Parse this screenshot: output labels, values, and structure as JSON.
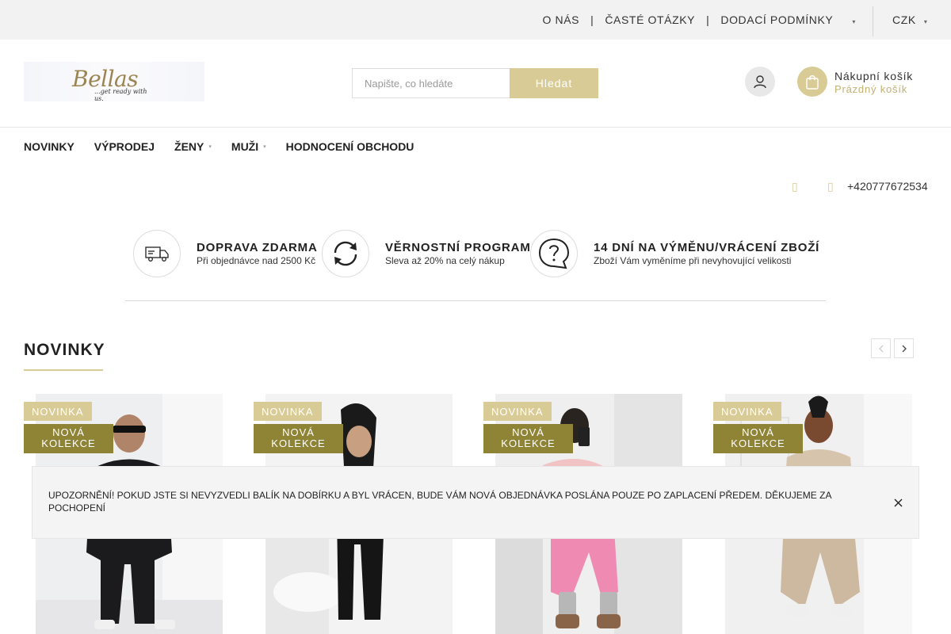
{
  "topbar": {
    "links": [
      "O NÁS",
      "ČASTÉ OTÁZKY",
      "DODACÍ PODMÍNKY"
    ],
    "separator": "|",
    "currency": "CZK"
  },
  "header": {
    "logo_text": "Bellas",
    "logo_tagline": "...get ready with us.",
    "search_placeholder": "Napište, co hledáte",
    "search_button": "Hledat",
    "cart_title": "Nákupní košík",
    "cart_status": "Prázdný košík"
  },
  "nav": {
    "items": [
      {
        "label": "NOVINKY",
        "dropdown": false
      },
      {
        "label": "VÝPRODEJ",
        "dropdown": false
      },
      {
        "label": "ŽENY",
        "dropdown": true
      },
      {
        "label": "MUŽI",
        "dropdown": true
      },
      {
        "label": "HODNOCENÍ OBCHODU",
        "dropdown": false
      }
    ],
    "phone": "+420777672534"
  },
  "benefits": [
    {
      "title": "DOPRAVA ZDARMA",
      "subtitle": "Při objednávce nad 2500 Kč",
      "icon": "delivery-truck-icon"
    },
    {
      "title": "VĚRNOSTNÍ PROGRAM",
      "subtitle": "Sleva až 20% na celý nákup",
      "icon": "loyalty-refresh-icon"
    },
    {
      "title": "14 DNÍ NA VÝMĚNU/VRÁCENÍ ZBOŽÍ",
      "subtitle": "Zboží Vám vyměníme při nevyhovující velikosti",
      "icon": "question-bubble-icon"
    }
  ],
  "section": {
    "title": "NOVINKY"
  },
  "products": [
    {
      "badge_new": "NOVINKA",
      "badge_collection": "NOVÁ KOLEKCE"
    },
    {
      "badge_new": "NOVINKA",
      "badge_collection": "NOVÁ KOLEKCE"
    },
    {
      "badge_new": "NOVINKA",
      "badge_collection": "NOVÁ KOLEKCE"
    },
    {
      "badge_new": "NOVINKA",
      "badge_collection": "NOVÁ KOLEKCE"
    }
  ],
  "notice": {
    "text": "UPOZORNĚNÍ! POKUD JSTE SI NEVYZVEDLI BALÍK NA DOBÍRKU A BYL VRÁCEN, BUDE VÁM NOVÁ OBJEDNÁVKA POSLÁNA POUZE PO ZAPLACENÍ PŘEDEM. DĚKUJEME ZA POCHOPENÍ"
  },
  "colors": {
    "accent": "#d9cb95",
    "badge_collection": "#8f8336",
    "topbar_bg": "#f2f2f2"
  }
}
